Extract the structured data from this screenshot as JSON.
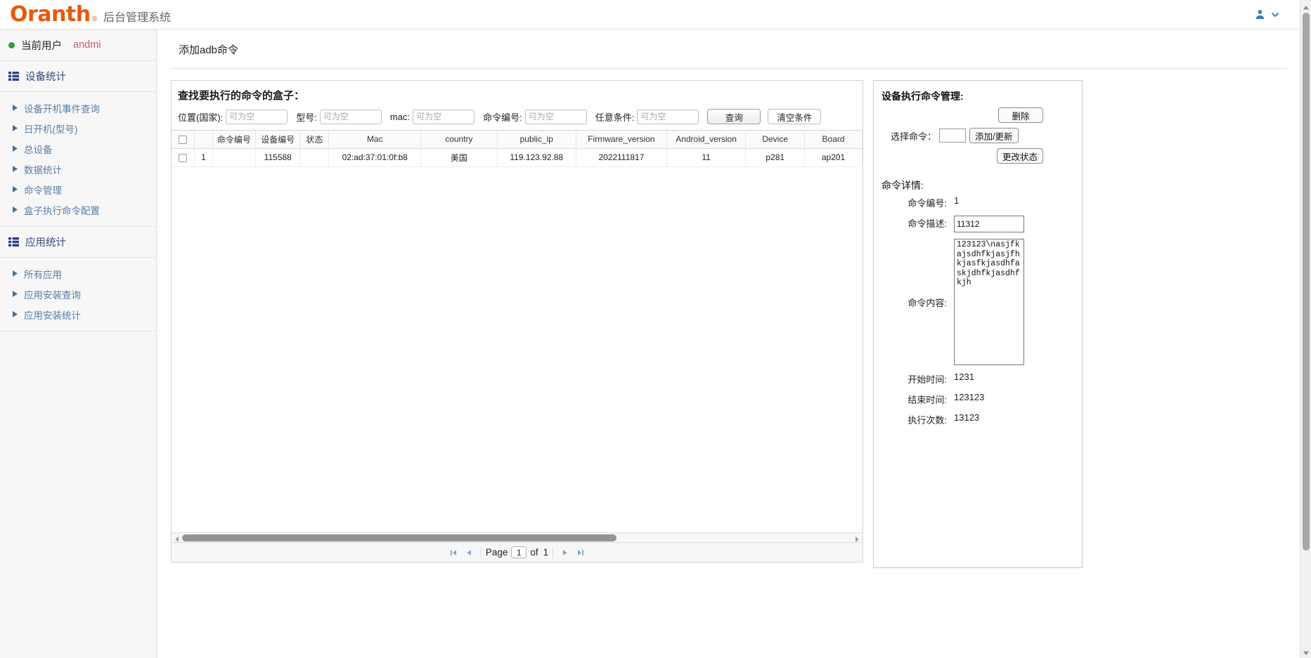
{
  "topbar": {
    "brand": "Oranth",
    "brand_reg": "®",
    "subtitle": "后台管理系统",
    "user_icon": "user-icon",
    "chevron_icon": "chevron-down-icon"
  },
  "sidebar": {
    "current_user": {
      "label": "当前用户",
      "name": "andmi"
    },
    "groups": [
      {
        "title": "设备统计",
        "icon": "list-grid-icon",
        "items": [
          {
            "label": "设备开机事件查询"
          },
          {
            "label": "日开机(型号)"
          },
          {
            "label": "总设备"
          },
          {
            "label": "数据统计"
          },
          {
            "label": "命令管理"
          },
          {
            "label": "盒子执行命令配置"
          }
        ]
      },
      {
        "title": "应用统计",
        "icon": "list-grid-icon",
        "items": [
          {
            "label": "所有应用"
          },
          {
            "label": "应用安装查询"
          },
          {
            "label": "应用安装统计"
          }
        ]
      }
    ]
  },
  "page": {
    "title": "添加adb命令"
  },
  "search_panel": {
    "heading": "查找要执行的命令的盒子：",
    "fields": [
      {
        "label": "位置(国家):",
        "value": "",
        "placeholder": "可为空",
        "name": "country-input"
      },
      {
        "label": "型号:",
        "value": "",
        "placeholder": "可为空",
        "name": "model-input"
      },
      {
        "label": "mac:",
        "value": "",
        "placeholder": "可为空",
        "name": "mac-input"
      },
      {
        "label": "命令编号:",
        "value": "",
        "placeholder": "可为空",
        "name": "command-id-input"
      },
      {
        "label": "任意条件:",
        "value": "",
        "placeholder": "可为空",
        "name": "any-condition-input"
      }
    ],
    "search_button": "查询",
    "clear_button": "清空条件"
  },
  "table": {
    "columns": [
      "",
      "",
      "命令编号",
      "设备编号",
      "状态",
      "Mac",
      "country",
      "public_ip",
      "Firmware_version",
      "Android_version",
      "Device",
      "Board"
    ],
    "rows": [
      {
        "index": "1",
        "command_id": "",
        "device_id": "115588",
        "status": "",
        "mac": "02:ad:37:01:0f:b8",
        "country": "美国",
        "public_ip": "119.123.92.88",
        "firmware_version": "2022111817",
        "android_version": "11",
        "device": "p281",
        "board": "ap201"
      }
    ]
  },
  "pager": {
    "first_icon": "first-page-icon",
    "prev_icon": "prev-page-icon",
    "page_label": "Page",
    "page_value": "1",
    "of_label": "of",
    "total_pages": "1",
    "next_icon": "next-page-icon",
    "last_icon": "last-page-icon"
  },
  "right_panel": {
    "mgmt_heading": "设备执行命令管理:",
    "delete_button": "删除",
    "select_command_label": "选择命令：",
    "select_command_value": "",
    "add_update_button": "添加/更新",
    "change_status_button": "更改状态",
    "detail_heading": "命令详情:",
    "details": {
      "command_id_label": "命令编号:",
      "command_id_value": "1",
      "desc_label": "命令描述:",
      "desc_value": "11312",
      "content_label": "命令内容:",
      "content_value": "123123\\nasjfkajsdhfkjasjfhkjasfkjasdhfaskjdhfkjasdhfkjh",
      "start_label": "开始时间:",
      "start_value": "1231",
      "end_label": "结束时间:",
      "end_value": "123123",
      "count_label": "执行次数:",
      "count_value": "13123"
    }
  },
  "colors": {
    "brand": "#e8590c",
    "sidebar_bg": "#f7f7f7",
    "group_title": "#3a4a7a",
    "menu_link": "#5a7fa6",
    "user_name": "#c95a70",
    "online_dot": "#2e9e3e"
  }
}
